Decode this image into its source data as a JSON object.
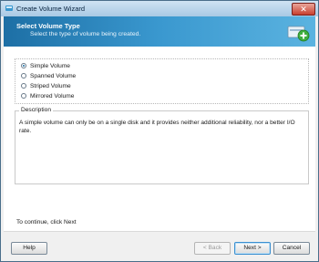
{
  "window": {
    "title": "Create Volume Wizard",
    "close_label": "✕"
  },
  "header": {
    "title": "Select Volume Type",
    "subtitle": "Select the type of volume being created."
  },
  "volume_types": {
    "selected": "Simple Volume",
    "options": [
      "Simple Volume",
      "Spanned Volume",
      "Striped Volume",
      "Mirrored Volume"
    ]
  },
  "description": {
    "label": "Description",
    "text": "A simple volume can only be on a single disk and it provides neither additional reliability, nor a better I/O rate."
  },
  "hint": "To continue, click Next",
  "buttons": {
    "help": "Help",
    "back": "< Back",
    "next": "Next >",
    "cancel": "Cancel"
  },
  "colors": {
    "header_gradient_start": "#1d6fa5",
    "header_gradient_end": "#5bb3e0",
    "accent": "#3a8fd0"
  }
}
